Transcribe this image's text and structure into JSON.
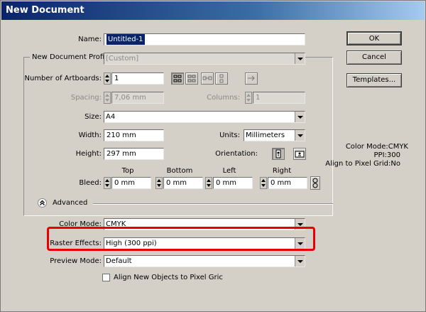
{
  "window": {
    "title": "New Document"
  },
  "buttons": {
    "ok": "OK",
    "cancel": "Cancel",
    "templates": "Templates..."
  },
  "name": {
    "label": "Name:",
    "value": "Untitled-1"
  },
  "profile": {
    "legend": "New Document Profile:",
    "value": "[Custom]"
  },
  "artboards": {
    "label": "Number of Artboards:",
    "value": "1"
  },
  "spacing": {
    "label": "Spacing:",
    "value": "7,06 mm"
  },
  "columns": {
    "label": "Columns:",
    "value": "1"
  },
  "size": {
    "label": "Size:",
    "value": "A4"
  },
  "width": {
    "label": "Width:",
    "value": "210 mm"
  },
  "units": {
    "label": "Units:",
    "value": "Millimeters"
  },
  "height": {
    "label": "Height:",
    "value": "297 mm"
  },
  "orientation": {
    "label": "Orientation:"
  },
  "bleed": {
    "label": "Bleed:",
    "top": {
      "label": "Top",
      "value": "0 mm"
    },
    "bottom": {
      "label": "Bottom",
      "value": "0 mm"
    },
    "left": {
      "label": "Left",
      "value": "0 mm"
    },
    "right": {
      "label": "Right",
      "value": "0 mm"
    }
  },
  "advanced": {
    "label": "Advanced"
  },
  "color_mode": {
    "label": "Color Mode:",
    "value": "CMYK"
  },
  "raster_effects": {
    "label": "Raster Effects:",
    "value": "High (300 ppi)"
  },
  "preview_mode": {
    "label": "Preview Mode:",
    "value": "Default"
  },
  "align_pixel": {
    "label": "Align New Objects to Pixel Gric"
  },
  "info": {
    "color_mode": "Color Mode:CMYK",
    "ppi": "PPI:300",
    "align": "Align to Pixel Grid:No"
  },
  "colors": {
    "title_start": "#0a246a",
    "title_end": "#a6caf0",
    "highlight_box": "#e80000",
    "dialog_bg": "#d4d0c8"
  },
  "icons": {
    "artboard_layout": [
      "grid-by-row-icon",
      "grid-by-column-icon",
      "arrange-by-row-icon",
      "arrange-by-column-icon",
      "arrow-right-icon"
    ],
    "orientation": [
      "portrait-icon",
      "landscape-icon"
    ],
    "bleed_link": "chain-link-icon",
    "advanced_toggle": "chevron-up-icon"
  }
}
